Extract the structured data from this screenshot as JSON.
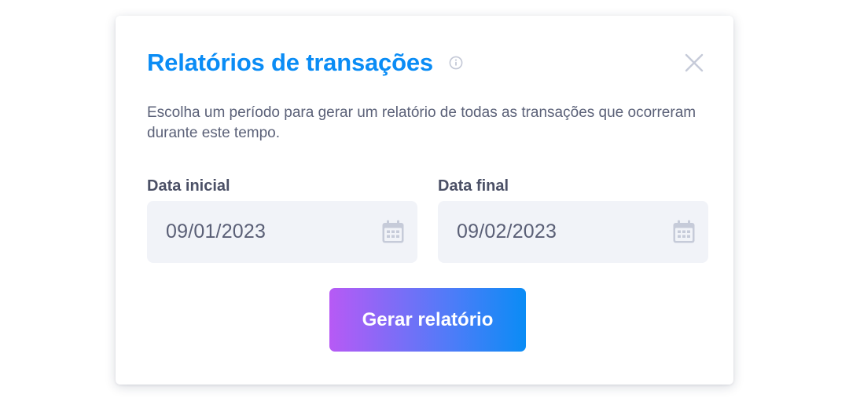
{
  "modal": {
    "title": "Relatórios de transações",
    "description": "Escolha um período para gerar um relatório de todas as transações que ocorreram durante este tempo.",
    "start_date": {
      "label": "Data inicial",
      "value": "09/01/2023"
    },
    "end_date": {
      "label": "Data final",
      "value": "09/02/2023"
    },
    "submit_label": "Gerar relatório",
    "icons": {
      "info": "info-icon",
      "close": "close-icon",
      "calendar": "calendar-icon"
    }
  },
  "colors": {
    "title": "#0a8cf5",
    "text": "#5b6178",
    "label": "#4b5066",
    "input_background": "#f1f3f8",
    "icon": "#c6cbd9",
    "button_gradient_start": "#b75af5",
    "button_gradient_end": "#0a8cf5"
  }
}
